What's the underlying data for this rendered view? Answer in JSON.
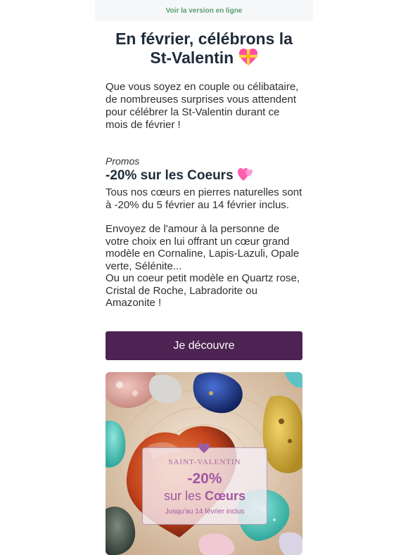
{
  "topbar": {
    "view_online": "Voir la version en ligne"
  },
  "header": {
    "title": "En février, célébrons la St-Valentin"
  },
  "intro": "Que vous soyez en couple ou célibataire, de nombreuses surprises vous attendent pour célébrer la St-Valentin durant ce mois de février !",
  "promo": {
    "kicker": "Promos",
    "title": "-20% sur les Coeurs",
    "p1": "Tous nos cœurs en pierres naturelles sont à -20% du 5 février au 14 février inclus.",
    "p2a": "Envoyez de l'amour à la personne de votre choix en lui offrant un cœur grand modèle en Cornaline, Lapis-Lazuli, Opale verte, Sélénite...",
    "p2b": "Ou un coeur petit modèle en Quartz rose, Cristal de Roche, Labradorite ou Amazonite !",
    "cta": "Je découvre"
  },
  "hero": {
    "line1": "SAINT-VALENTIN",
    "line2": "-20%",
    "line3a": "sur les ",
    "line3b": "Cœurs",
    "line4": "Jusqu'au 14 février inclus"
  },
  "icons": {
    "title_emoji": "heart-with-ribbon-icon",
    "promo_emoji": "two-hearts-icon",
    "overlay": "heart-icon"
  },
  "colors": {
    "accent": "#4c2352",
    "title": "#1f2b3a",
    "link": "#5a9e70",
    "overlay_text": "#a257a0"
  }
}
